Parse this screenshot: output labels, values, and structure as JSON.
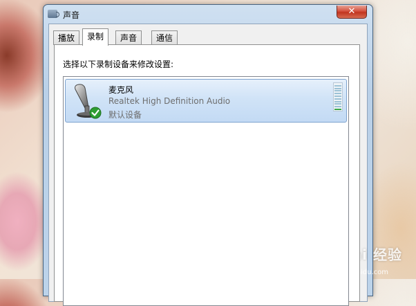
{
  "window": {
    "title": "声音",
    "close_glyph": "✕"
  },
  "tabs": [
    {
      "label": "播放",
      "active": false
    },
    {
      "label": "录制",
      "active": true
    },
    {
      "label": "声音",
      "active": false
    },
    {
      "label": "通信",
      "active": false
    }
  ],
  "panel": {
    "instruction": "选择以下录制设备来修改设置:"
  },
  "device": {
    "name": "麦克风",
    "driver": "Realtek High Definition Audio",
    "status": "默认设备",
    "icon": "microphone-icon",
    "badge_icon": "default-check-icon",
    "level_fraction": 0.1
  },
  "annotation": {
    "icon": "red-arrow-icon",
    "color": "#e0141e"
  },
  "watermark": {
    "text": "Bai 经验",
    "url": "jingyan.baidu.com"
  }
}
